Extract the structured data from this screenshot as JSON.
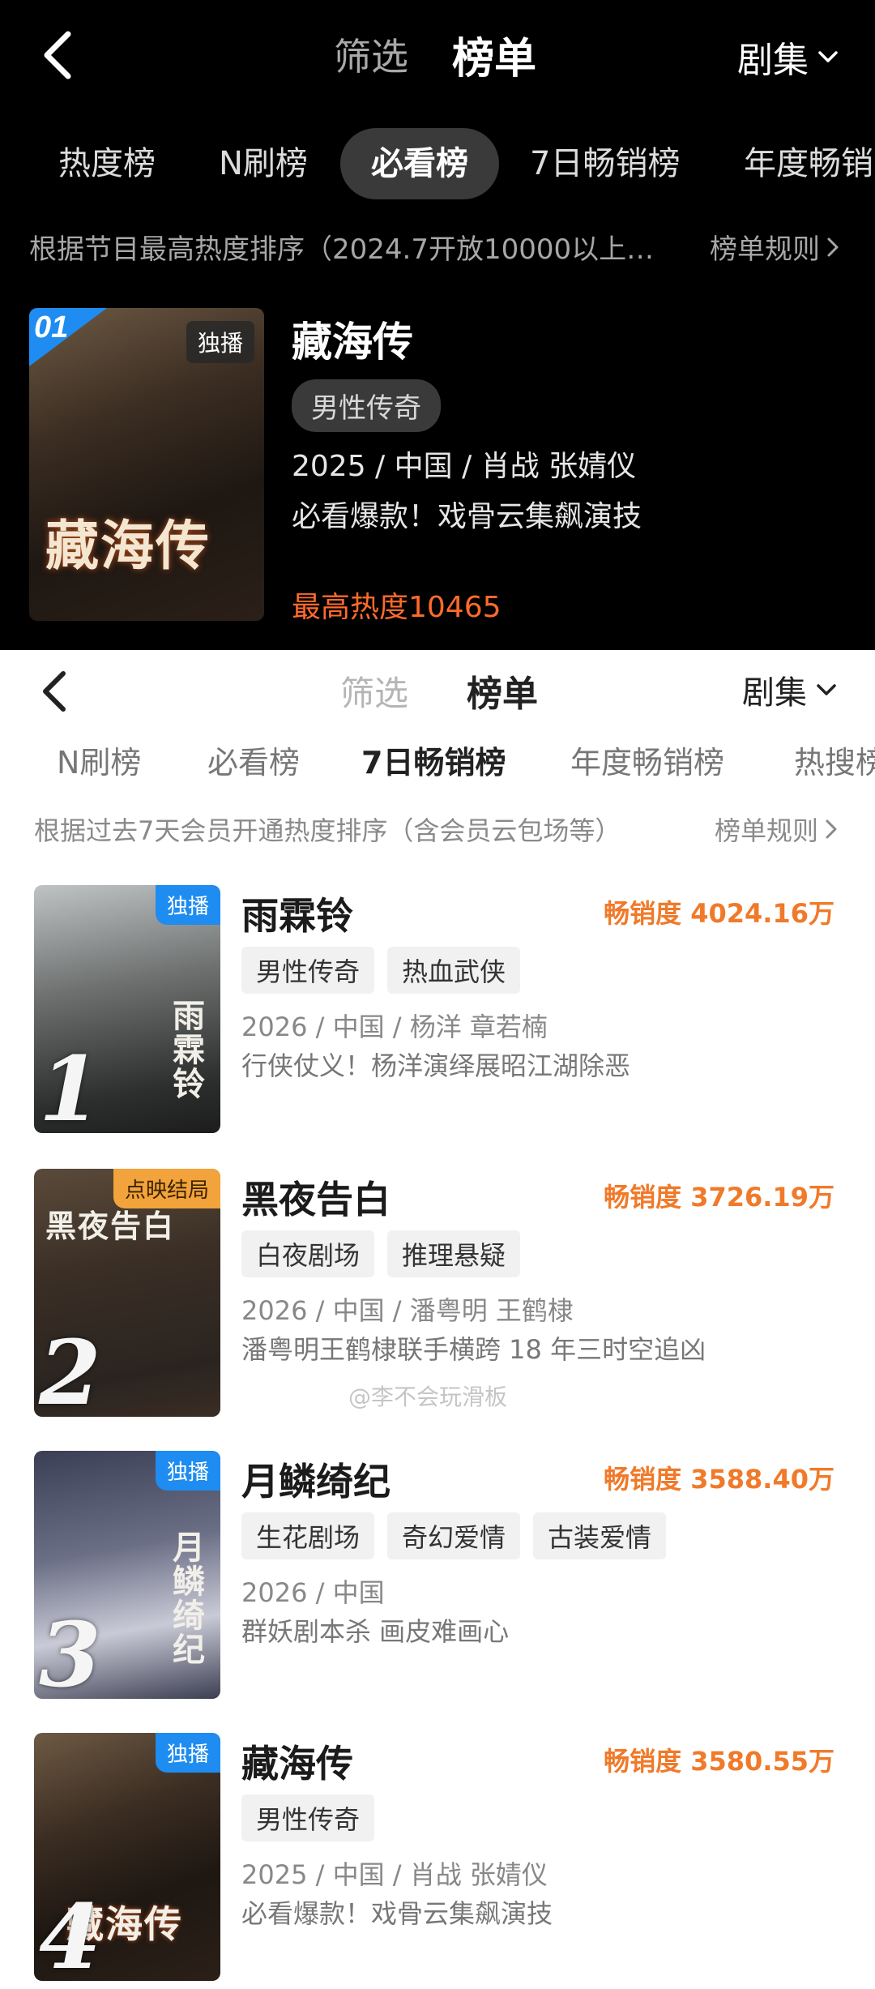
{
  "dark": {
    "nav": {
      "filter": "筛选",
      "rank": "榜单",
      "category": "剧集"
    },
    "tabs": [
      "热度榜",
      "N刷榜",
      "必看榜",
      "7日畅销榜",
      "年度畅销"
    ],
    "active_tab": "必看榜",
    "description": "根据节目最高热度排序（2024.7开放10000以上…",
    "rule": "榜单规则",
    "featured": {
      "rank": "01",
      "badge": "独播",
      "poster_art": "藏海传",
      "title": "藏海传",
      "tag": "男性传奇",
      "meta": "2025 / 中国 / 肖战 张婧仪",
      "subtitle": "必看爆款！戏骨云集飙演技",
      "heat": "最高热度10465"
    }
  },
  "light": {
    "nav": {
      "filter": "筛选",
      "rank": "榜单",
      "category": "剧集"
    },
    "tabs": [
      "N刷榜",
      "必看榜",
      "7日畅销榜",
      "年度畅销榜",
      "热搜榜"
    ],
    "active_tab": "7日畅销榜",
    "description": "根据过去7天会员开通热度排序（含会员云包场等）",
    "rule": "榜单规则",
    "watermark": "@李不会玩滑板",
    "items": [
      {
        "rank": "1",
        "badge": "独播",
        "poster_art": "雨霖铃",
        "title": "雨霖铃",
        "sales": "畅销度 4024.16万",
        "tags": [
          "男性传奇",
          "热血武侠"
        ],
        "meta": "2026 / 中国 / 杨洋 章若楠",
        "subtitle": "行侠仗义！杨洋演绎展昭江湖除恶"
      },
      {
        "rank": "2",
        "badge": "点映结局",
        "poster_art": "黑夜告白",
        "title": "黑夜告白",
        "sales": "畅销度 3726.19万",
        "tags": [
          "白夜剧场",
          "推理悬疑"
        ],
        "meta": "2026 / 中国 / 潘粤明 王鹤棣",
        "subtitle": "潘粤明王鹤棣联手横跨 18 年三时空追凶"
      },
      {
        "rank": "3",
        "badge": "独播",
        "poster_art": "月鳞绮纪",
        "title": "月鳞绮纪",
        "sales": "畅销度 3588.40万",
        "tags": [
          "生花剧场",
          "奇幻爱情",
          "古装爱情"
        ],
        "meta": "2026 / 中国",
        "subtitle": "群妖剧本杀 画皮难画心"
      },
      {
        "rank": "4",
        "badge": "独播",
        "poster_art": "藏海传",
        "title": "藏海传",
        "sales": "畅销度 3580.55万",
        "tags": [
          "男性传奇"
        ],
        "meta": "2025 / 中国 / 肖战 张婧仪",
        "subtitle": "必看爆款！戏骨云集飙演技"
      }
    ]
  },
  "colors": {
    "heat_orange": "#ff6a2a",
    "sales_orange": "#f07a2a",
    "exclusive_blue": "#1e8cf0",
    "finale_orange": "#f2a33b"
  },
  "icons": [
    "back-arrow-icon",
    "chevron-down-icon",
    "chevron-right-icon"
  ]
}
